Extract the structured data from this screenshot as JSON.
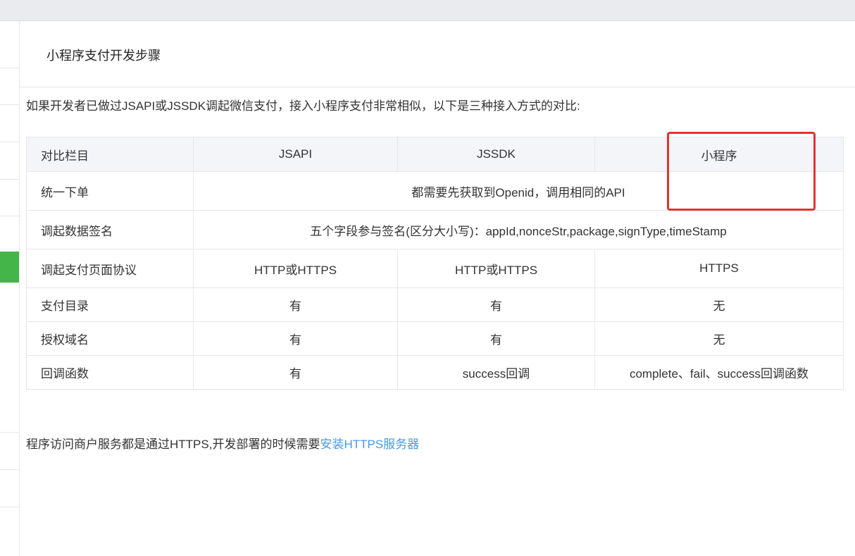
{
  "page": {
    "title": "小程序支付开发步骤",
    "intro": "如果开发者已做过JSAPI或JSSDK调起微信支付，接入小程序支付非常相似，以下是三种接入方式的对比:"
  },
  "table": {
    "headers": [
      "对比栏目",
      "JSAPI",
      "JSSDK",
      "小程序"
    ],
    "rows": [
      {
        "label": "统一下单",
        "merged": "都需要先获取到Openid，调用相同的API"
      },
      {
        "label": "调起数据签名",
        "merged": "五个字段参与签名(区分大小写)：appId,nonceStr,package,signType,timeStamp"
      },
      {
        "label": "调起支付页面协议",
        "cells": [
          "HTTP或HTTPS",
          "HTTP或HTTPS",
          "HTTPS"
        ]
      },
      {
        "label": "支付目录",
        "cells": [
          "有",
          "有",
          "无"
        ]
      },
      {
        "label": "授权域名",
        "cells": [
          "有",
          "有",
          "无"
        ]
      },
      {
        "label": "回调函数",
        "cells": [
          "有",
          "success回调",
          "complete、fail、success回调函数"
        ]
      }
    ]
  },
  "footer": {
    "text": "程序访问商户服务都是通过HTTPS,开发部署的时候需要",
    "link_label": "安装HTTPS服务器"
  },
  "colors": {
    "sidebar_active": "#44b549",
    "link": "#459ae9",
    "highlight_box": "#e8322e",
    "table_header_bg": "#f4f5f9"
  }
}
